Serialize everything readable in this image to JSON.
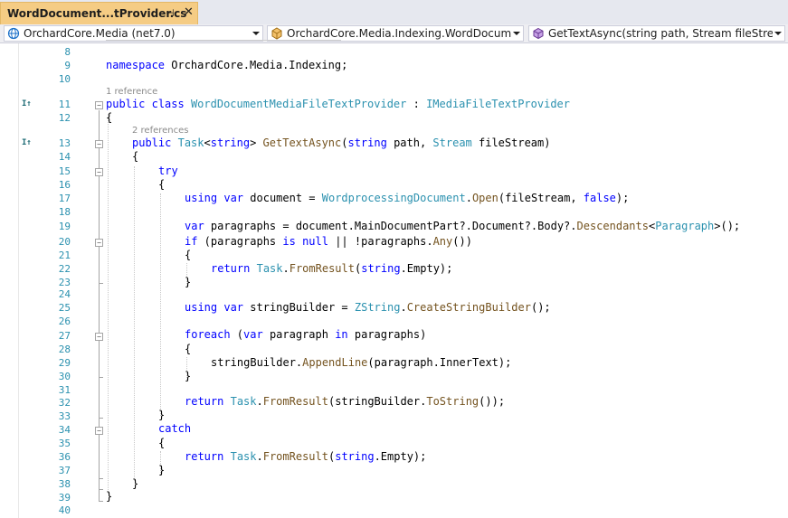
{
  "tab": {
    "title": "WordDocument...tProvider.cs",
    "pin": "⊣",
    "close": "✕"
  },
  "navbar": {
    "project": "OrchardCore.Media (net7.0)",
    "type": "OrchardCore.Media.Indexing.WordDocumentM",
    "member": "GetTextAsync(string path, Stream fileStream)"
  },
  "codelens": {
    "class_refs": "1 reference",
    "method_refs": "2 references"
  },
  "margin_icons": {
    "implements": "I↑"
  },
  "lines": [
    {
      "n": "8"
    },
    {
      "n": "9"
    },
    {
      "n": "10"
    },
    {
      "n": "11"
    },
    {
      "n": "12"
    },
    {
      "n": "13"
    },
    {
      "n": "14"
    },
    {
      "n": "15"
    },
    {
      "n": "16"
    },
    {
      "n": "17"
    },
    {
      "n": "18"
    },
    {
      "n": "19"
    },
    {
      "n": "20"
    },
    {
      "n": "21"
    },
    {
      "n": "22"
    },
    {
      "n": "23"
    },
    {
      "n": "24"
    },
    {
      "n": "25"
    },
    {
      "n": "26"
    },
    {
      "n": "27"
    },
    {
      "n": "28"
    },
    {
      "n": "29"
    },
    {
      "n": "30"
    },
    {
      "n": "31"
    },
    {
      "n": "32"
    },
    {
      "n": "33"
    },
    {
      "n": "34"
    },
    {
      "n": "35"
    },
    {
      "n": "36"
    },
    {
      "n": "37"
    },
    {
      "n": "38"
    },
    {
      "n": "39"
    },
    {
      "n": "40"
    }
  ],
  "code": {
    "l9": {
      "a": "namespace",
      "b": " OrchardCore.Media.Indexing;"
    },
    "l11": {
      "a": "public",
      "b": " ",
      "c": "class",
      "d": " ",
      "e": "WordDocumentMediaFileTextProvider",
      "f": " : ",
      "g": "IMediaFileTextProvider"
    },
    "l12": "{",
    "l13": {
      "a": "public",
      "b": " ",
      "c": "Task",
      "d": "<",
      "e": "string",
      "f": "> ",
      "g": "GetTextAsync",
      "h": "(",
      "i": "string",
      "j": " path, ",
      "k": "Stream",
      "l": " fileStream)"
    },
    "l14": "{",
    "l15": "try",
    "l16": "{",
    "l17": {
      "a": "using",
      "b": " ",
      "c": "var",
      "d": " document = ",
      "e": "WordprocessingDocument",
      "f": ".",
      "g": "Open",
      "h": "(fileStream, ",
      "i": "false",
      "j": ");"
    },
    "l19": {
      "a": "var",
      "b": " paragraphs = document.MainDocumentPart?.Document?.Body?.",
      "c": "Descendants",
      "d": "<",
      "e": "Paragraph",
      "f": ">();"
    },
    "l20": {
      "a": "if",
      "b": " (paragraphs ",
      "c": "is",
      "d": " ",
      "e": "null",
      "f": " || !paragraphs.",
      "g": "Any",
      "h": "())"
    },
    "l21": "{",
    "l22": {
      "a": "return",
      "b": " ",
      "c": "Task",
      "d": ".",
      "e": "FromResult",
      "f": "(",
      "g": "string",
      "h": ".Empty);"
    },
    "l23": "}",
    "l25": {
      "a": "using",
      "b": " ",
      "c": "var",
      "d": " stringBuilder = ",
      "e": "ZString",
      "f": ".",
      "g": "CreateStringBuilder",
      "h": "();"
    },
    "l27": {
      "a": "foreach",
      "b": " (",
      "c": "var",
      "d": " paragraph ",
      "e": "in",
      "f": " paragraphs)"
    },
    "l28": "{",
    "l29": {
      "a": "stringBuilder.",
      "b": "AppendLine",
      "c": "(paragraph.InnerText);"
    },
    "l30": "}",
    "l32": {
      "a": "return",
      "b": " ",
      "c": "Task",
      "d": ".",
      "e": "FromResult",
      "f": "(stringBuilder.",
      "g": "ToString",
      "h": "());"
    },
    "l33": "}",
    "l34": "catch",
    "l35": "{",
    "l36": {
      "a": "return",
      "b": " ",
      "c": "Task",
      "d": ".",
      "e": "FromResult",
      "f": "(",
      "g": "string",
      "h": ".Empty);"
    },
    "l37": "}",
    "l38": "}",
    "l39": "}"
  },
  "colors": {
    "keyword": "#0000ff",
    "type": "#2b91af",
    "method": "#74531f",
    "tab_active": "#f5cc84",
    "line_number": "#2b91af"
  }
}
